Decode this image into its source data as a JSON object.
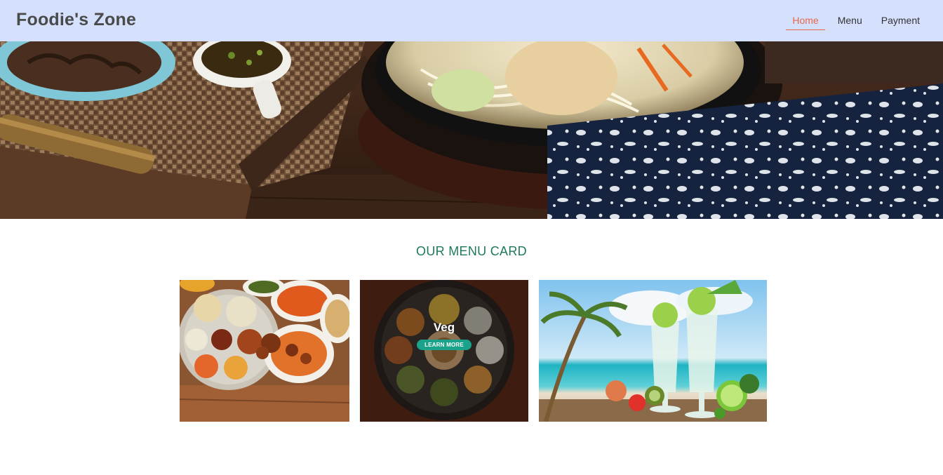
{
  "header": {
    "brand": "Foodie's Zone",
    "nav": [
      {
        "label": "Home",
        "active": true
      },
      {
        "label": "Menu",
        "active": false
      },
      {
        "label": "Payment",
        "active": false
      }
    ]
  },
  "menu_section": {
    "title": "OUR MENU CARD",
    "cards": [
      {
        "id": "non-veg",
        "image": "non-veg-thali-photo"
      },
      {
        "id": "veg",
        "image": "veg-thali-photo",
        "label": "Veg",
        "button": "LEARN MORE"
      },
      {
        "id": "drinks",
        "image": "mojito-drinks-photo"
      }
    ]
  },
  "colors": {
    "header_bg": "#d5e0fd",
    "nav_active": "#e8664a",
    "section_title": "#1f7a5a",
    "button_bg": "#1aa38a"
  }
}
